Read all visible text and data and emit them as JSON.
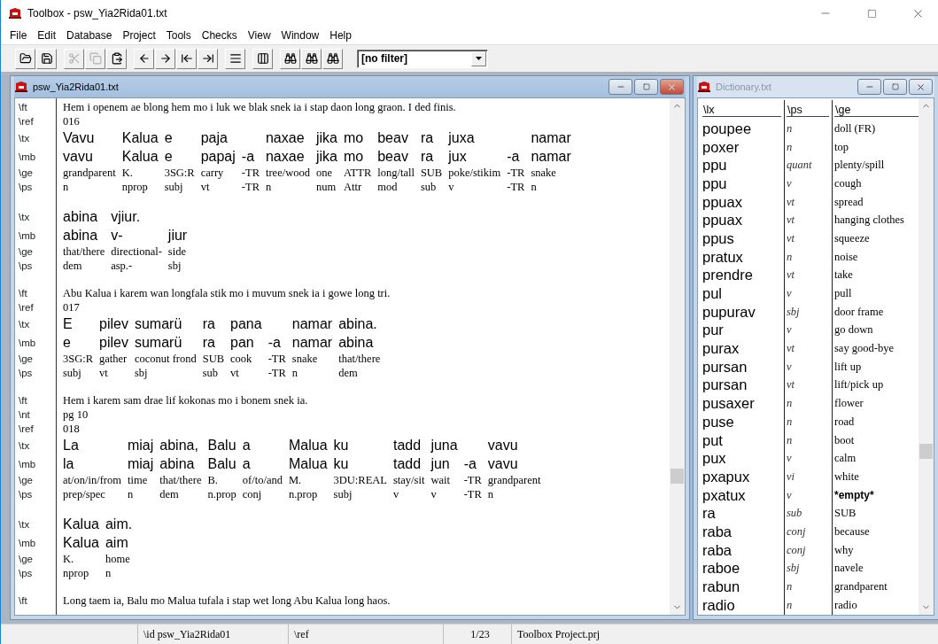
{
  "app": {
    "title": "Toolbox - psw_Yia2Rida01.txt"
  },
  "menu": [
    "File",
    "Edit",
    "Database",
    "Project",
    "Tools",
    "Checks",
    "View",
    "Window",
    "Help"
  ],
  "toolbar": {
    "groups": [
      [
        {
          "kind": "open",
          "disabled": false
        },
        {
          "kind": "save",
          "disabled": false
        }
      ],
      [
        {
          "kind": "cut",
          "disabled": true
        },
        {
          "kind": "copy",
          "disabled": true
        },
        {
          "kind": "paste",
          "disabled": false
        }
      ],
      [
        {
          "kind": "prev",
          "disabled": false
        },
        {
          "kind": "next",
          "disabled": false
        },
        {
          "kind": "first",
          "disabled": false
        },
        {
          "kind": "last",
          "disabled": false
        }
      ],
      [
        {
          "kind": "interlinear",
          "disabled": false
        }
      ],
      [
        {
          "kind": "browse",
          "disabled": false
        }
      ],
      [
        {
          "kind": "find",
          "disabled": false
        },
        {
          "kind": "find",
          "disabled": false
        },
        {
          "kind": "find",
          "disabled": false
        }
      ]
    ]
  },
  "filter": {
    "value": "[no filter]"
  },
  "text_window": {
    "title": "psw_Yia2Rida01.txt",
    "active": true,
    "lines": [
      {
        "kind": "text",
        "marker": "\\ft",
        "text": "Hem i openem ae blong hem mo i luk we blak snek ia i stap daon long graon. I ded finis."
      },
      {
        "kind": "text",
        "marker": "\\ref",
        "text": "016"
      },
      {
        "kind": "gloss",
        "markers": [
          "\\tx",
          "\\mb",
          "\\ge",
          "\\ps"
        ],
        "columns": [
          [
            "Vavu",
            "vavu",
            "grandparent",
            "n"
          ],
          [
            "Kalua",
            "Kalua",
            "K.",
            "nprop"
          ],
          [
            "e",
            "e",
            "3SG:R",
            "subj"
          ],
          [
            "paja",
            "papaj",
            "carry",
            "vt"
          ],
          [
            "",
            "-a",
            "-TR",
            "-TR"
          ],
          [
            "naxae",
            "naxae",
            "tree/wood",
            "n"
          ],
          [
            "jika",
            "jika",
            "one",
            "num"
          ],
          [
            "mo",
            "mo",
            "ATTR",
            "Attr"
          ],
          [
            "beav",
            "beav",
            "long/tall",
            "mod"
          ],
          [
            "ra",
            "ra",
            "SUB",
            "sub"
          ],
          [
            "juxa",
            "jux",
            "poke/stikim",
            "v"
          ],
          [
            "",
            "-a",
            "-TR",
            "-TR"
          ],
          [
            "namar",
            "namar",
            "snake",
            "n"
          ]
        ]
      },
      {
        "kind": "blank"
      },
      {
        "kind": "gloss",
        "markers": [
          "\\tx",
          "\\mb",
          "\\ge",
          "\\ps"
        ],
        "columns": [
          [
            "abina",
            "abina",
            "that/there",
            "dem"
          ],
          [
            "vjiur.",
            "v-",
            "directional-",
            "asp.-"
          ],
          [
            "",
            "jiur",
            "side",
            "sbj"
          ]
        ]
      },
      {
        "kind": "blank"
      },
      {
        "kind": "text",
        "marker": "\\ft",
        "text": "Abu Kalua i karem wan longfala stik mo i muvum snek ia i gowe long tri."
      },
      {
        "kind": "text",
        "marker": "\\ref",
        "text": "017"
      },
      {
        "kind": "gloss",
        "markers": [
          "\\tx",
          "\\mb",
          "\\ge",
          "\\ps"
        ],
        "columns": [
          [
            "E",
            "e",
            "3SG:R",
            "subj"
          ],
          [
            "pilev",
            "pilev",
            "gather",
            "vt"
          ],
          [
            "sumarü",
            "sumarü",
            "coconut  frond",
            "sbj"
          ],
          [
            "ra",
            "ra",
            "SUB",
            "sub"
          ],
          [
            "pana",
            "pan",
            "cook",
            "vt"
          ],
          [
            "",
            "-a",
            "-TR",
            "-TR"
          ],
          [
            "namar",
            "namar",
            "snake",
            "n"
          ],
          [
            "abina.",
            "abina",
            "that/there",
            "dem"
          ]
        ]
      },
      {
        "kind": "blank"
      },
      {
        "kind": "text",
        "marker": "\\ft",
        "text": "Hem i karem sam drae lif kokonas mo i bonem snek ia."
      },
      {
        "kind": "text",
        "marker": "\\nt",
        "text": "pg 10"
      },
      {
        "kind": "text",
        "marker": "\\ref",
        "text": "018"
      },
      {
        "kind": "gloss",
        "markers": [
          "\\tx",
          "\\mb",
          "\\ge",
          "\\ps"
        ],
        "columns": [
          [
            "La",
            "la",
            "at/on/in/from",
            "prep/spec"
          ],
          [
            "miaj",
            "miaj",
            "time",
            "n"
          ],
          [
            "abina,",
            "abina",
            "that/there",
            "dem"
          ],
          [
            "Balu",
            "Balu",
            "B.",
            "n.prop"
          ],
          [
            "a",
            "a",
            "of/to/and",
            "conj"
          ],
          [
            "Malua",
            "Malua",
            "M.",
            "n.prop"
          ],
          [
            "ku",
            "ku",
            "3DU:REAL",
            "subj"
          ],
          [
            "tadd",
            "tadd",
            "stay/sit",
            "v"
          ],
          [
            "juna",
            "jun",
            "wait",
            "v"
          ],
          [
            "",
            "-a",
            "-TR",
            "-TR"
          ],
          [
            "vavu",
            "vavu",
            "grandparent",
            "n"
          ]
        ]
      },
      {
        "kind": "blank"
      },
      {
        "kind": "gloss",
        "markers": [
          "\\tx",
          "\\mb",
          "\\ge",
          "\\ps"
        ],
        "columns": [
          [
            "Kalua",
            "Kalua",
            "K.",
            "nprop"
          ],
          [
            "aim.",
            "aim",
            "home",
            "n"
          ]
        ]
      },
      {
        "kind": "blank"
      },
      {
        "kind": "text",
        "marker": "\\ft",
        "text": "Long taem ia, Balu mo Malua tufala i stap wet long Abu Kalua long haos."
      }
    ]
  },
  "dictionary_window": {
    "title": "Dictionary.txt",
    "active": false,
    "columns": [
      "\\lx",
      "\\ps",
      "\\ge"
    ],
    "entries": [
      {
        "lx": "poupee",
        "ps": "n",
        "ge": "doll (FR)",
        "kind": "normal"
      },
      {
        "lx": "poxer",
        "ps": "n",
        "ge": "top",
        "kind": "normal"
      },
      {
        "lx": "ppu",
        "ps": "quant",
        "ge": "plenty/spill",
        "kind": "normal"
      },
      {
        "lx": "ppu",
        "ps": "v",
        "ge": "cough",
        "kind": "normal"
      },
      {
        "lx": "ppuax",
        "ps": "vt",
        "ge": "spread",
        "kind": "normal"
      },
      {
        "lx": "ppuax",
        "ps": "vt",
        "ge": "hanging clothes",
        "kind": "normal"
      },
      {
        "lx": "ppus",
        "ps": "vt",
        "ge": "squeeze",
        "kind": "normal"
      },
      {
        "lx": "pratux",
        "ps": "n",
        "ge": "noise",
        "kind": "normal"
      },
      {
        "lx": "prendre",
        "ps": "vt",
        "ge": "take",
        "kind": "normal"
      },
      {
        "lx": "pul",
        "ps": "v",
        "ge": "pull",
        "kind": "normal"
      },
      {
        "lx": "pupurav",
        "ps": "sbj",
        "ge": "door frame",
        "kind": "normal"
      },
      {
        "lx": "pur",
        "ps": "v",
        "ge": "go down",
        "kind": "normal"
      },
      {
        "lx": "purax",
        "ps": "vt",
        "ge": "say good-bye",
        "kind": "normal"
      },
      {
        "lx": "pursan",
        "ps": "v",
        "ge": "lift up",
        "kind": "normal"
      },
      {
        "lx": "pursan",
        "ps": "vt",
        "ge": "lift/pick up",
        "kind": "normal"
      },
      {
        "lx": "pusaxer",
        "ps": "n",
        "ge": "flower",
        "kind": "normal"
      },
      {
        "lx": "puse",
        "ps": "n",
        "ge": "road",
        "kind": "normal"
      },
      {
        "lx": "put",
        "ps": "n",
        "ge": "boot",
        "kind": "normal"
      },
      {
        "lx": "pux",
        "ps": "v",
        "ge": "calm",
        "kind": "normal"
      },
      {
        "lx": "pxapux",
        "ps": "vi",
        "ge": "white",
        "kind": "normal"
      },
      {
        "lx": "pxatux",
        "ps": "v",
        "ge": "*empty*",
        "kind": "empty"
      },
      {
        "lx": "ra",
        "ps": "sub",
        "ge": "SUB",
        "kind": "normal"
      },
      {
        "lx": "raba",
        "ps": "conj",
        "ge": "because",
        "kind": "normal"
      },
      {
        "lx": "raba",
        "ps": "conj",
        "ge": "why",
        "kind": "normal"
      },
      {
        "lx": "raboe",
        "ps": "sbj",
        "ge": "navele",
        "kind": "normal"
      },
      {
        "lx": "rabun",
        "ps": "n",
        "ge": "grandparent",
        "kind": "normal"
      },
      {
        "lx": "radio",
        "ps": "n",
        "ge": "radio",
        "kind": "normal"
      }
    ]
  },
  "status_bar": [
    "\\id psw_Yia2Rida01",
    "\\ref",
    "1/23",
    "Toolbox Project.prj"
  ]
}
